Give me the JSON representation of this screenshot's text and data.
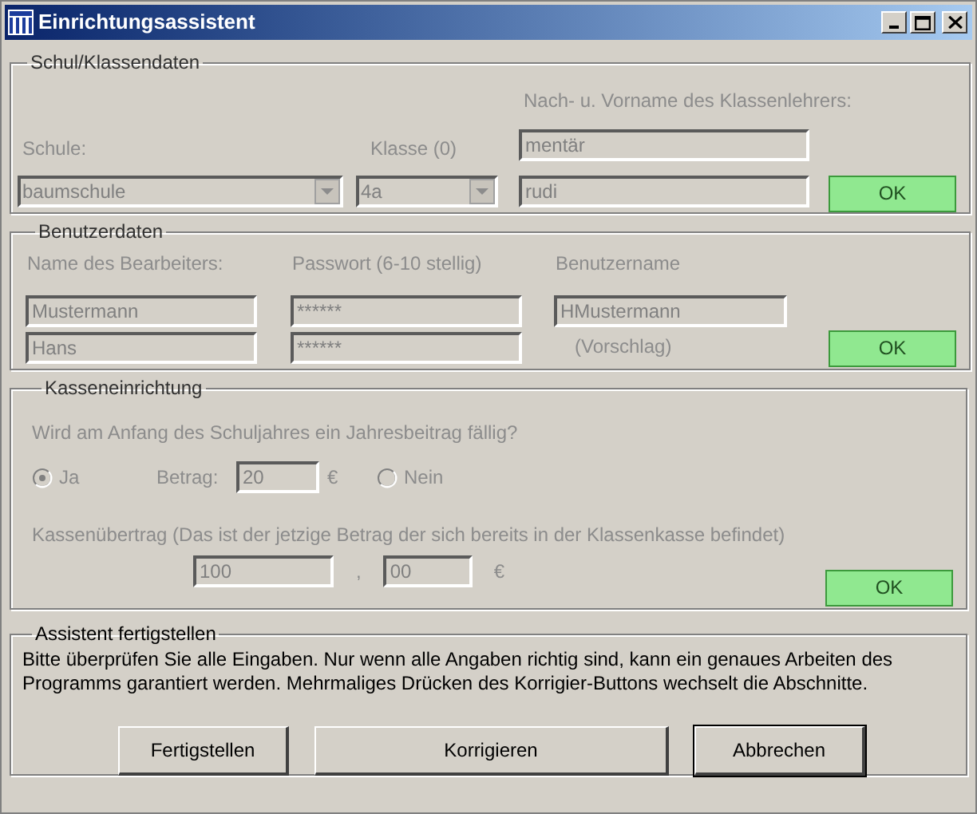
{
  "window": {
    "title": "Einrichtungsassistent"
  },
  "school": {
    "legend": "Schul/Klassendaten",
    "disabled": true,
    "school_label": "Schule:",
    "class_label": "Klasse (0)",
    "teacher_label": "Nach- u. Vorname des Klassenlehrers:",
    "teacher_last": "mentär",
    "school_value": "baumschule",
    "class_value": "4a",
    "teacher_first": "rudi",
    "ok": "OK"
  },
  "user": {
    "legend": "Benutzerdaten",
    "disabled": true,
    "name_label": "Name des Bearbeiters:",
    "password_label": "Passwort (6-10 stellig)",
    "username_label": "Benutzername",
    "last_name": "Mustermann",
    "password": "******",
    "username": "HMustermann",
    "first_name": "Hans",
    "password_repeat": "******",
    "username_note": "(Vorschlag)",
    "ok": "OK"
  },
  "cash": {
    "legend": "Kasseneinrichtung",
    "disabled": true,
    "question": "Wird am Anfang des Schuljahres ein Jahresbeitrag fällig?",
    "yes": {
      "label": "Ja",
      "selected": true
    },
    "amount_label": "Betrag:",
    "amount": "20",
    "currency": "€",
    "no": {
      "label": "Nein",
      "selected": false
    },
    "carry_label": "Kassenübertrag (Das ist der jetzige Betrag der sich bereits in der Klassenkasse befindet)",
    "carry_euros": "100",
    "separator": ",",
    "carry_cents": "00",
    "carry_currency": "€",
    "ok": "OK"
  },
  "finish": {
    "legend": "Assistent fertigstellen",
    "text": "Bitte überprüfen Sie alle Eingaben. Nur wenn alle Angaben richtig sind, kann ein genaues Arbeiten des Programms garantiert werden. Mehrmaliges Drücken des Korrigier-Buttons wechselt die Abschnitte.",
    "buttons": [
      {
        "label": "Fertigstellen",
        "default": false
      },
      {
        "label": "Korrigieren",
        "default": false
      },
      {
        "label": "Abbrechen",
        "default": true
      }
    ]
  }
}
